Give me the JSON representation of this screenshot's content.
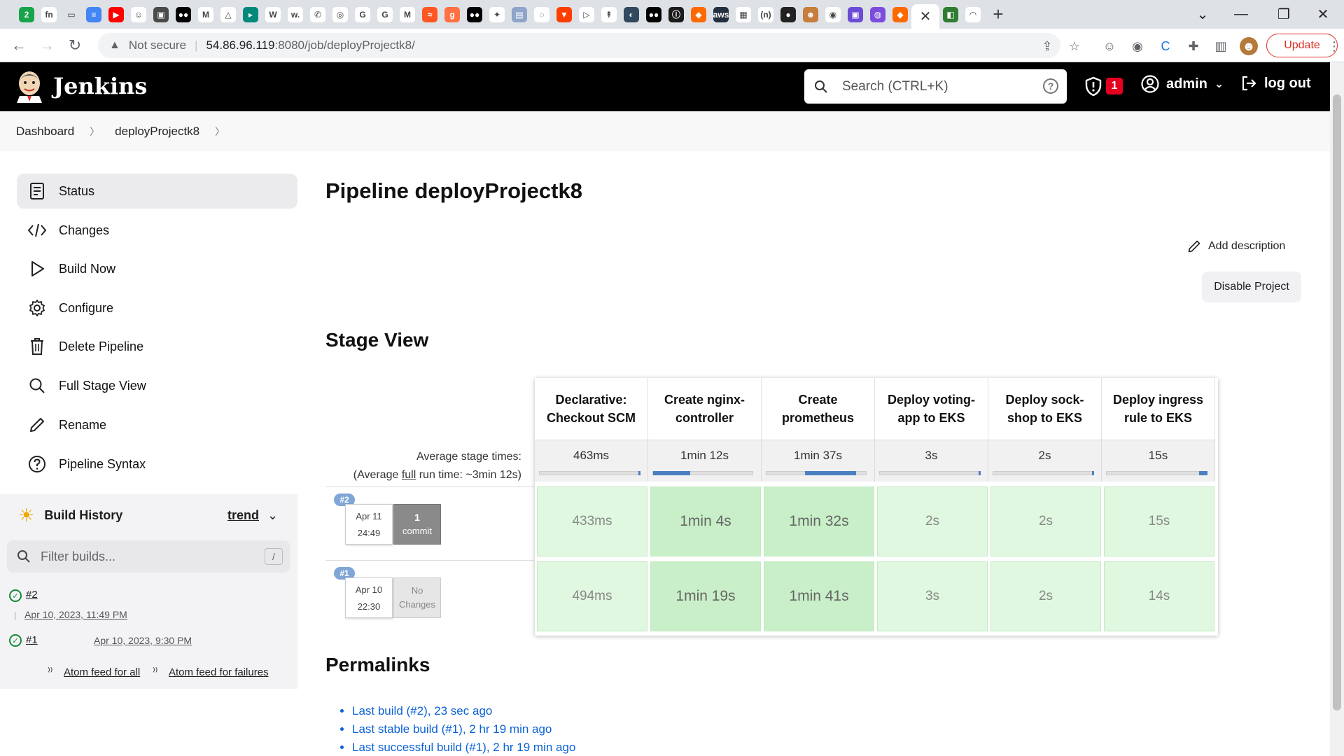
{
  "browser": {
    "tabs_favicons": [
      {
        "icon": "n8n-icon",
        "color": "#17a34a",
        "text": "2"
      },
      {
        "icon": "fn-icon",
        "color": "#ffffff",
        "text": "fn"
      },
      {
        "icon": "folder-icon",
        "color": "#dee1e6",
        "text": "▭"
      },
      {
        "icon": "docs-icon",
        "color": "#4285f4",
        "text": "≡"
      },
      {
        "icon": "youtube-icon",
        "color": "#ff0000",
        "text": "▶"
      },
      {
        "icon": "smiley-icon",
        "color": "#ffffff",
        "text": "☺"
      },
      {
        "icon": "photo-icon",
        "color": "#4a4a4a",
        "text": "▣"
      },
      {
        "icon": "medium-icon",
        "color": "#000000",
        "text": "●●"
      },
      {
        "icon": "gmail-icon",
        "color": "#ffffff",
        "text": "M"
      },
      {
        "icon": "drive-icon",
        "color": "#ffffff",
        "text": "△"
      },
      {
        "icon": "meet-icon",
        "color": "#00897b",
        "text": "▸"
      },
      {
        "icon": "w-icon",
        "color": "#ffffff",
        "text": "W"
      },
      {
        "icon": "w2-icon",
        "color": "#ffffff",
        "text": "w."
      },
      {
        "icon": "phone-icon",
        "color": "#ffffff",
        "text": "✆"
      },
      {
        "icon": "globe-icon",
        "color": "#ffffff",
        "text": "◎"
      },
      {
        "icon": "google-icon",
        "color": "#ffffff",
        "text": "G"
      },
      {
        "icon": "google2-icon",
        "color": "#ffffff",
        "text": "G"
      },
      {
        "icon": "gmail2-icon",
        "color": "#ffffff",
        "text": "M"
      },
      {
        "icon": "wave-icon",
        "color": "#ff5722",
        "text": "≈"
      },
      {
        "icon": "g-icon",
        "color": "#ff7043",
        "text": "g"
      },
      {
        "icon": "medium2-icon",
        "color": "#000000",
        "text": "●●"
      },
      {
        "icon": "star-icon",
        "color": "#ffffff",
        "text": "✦"
      },
      {
        "icon": "doc-icon",
        "color": "#8ea4c8",
        "text": "▤"
      },
      {
        "icon": "swirl-icon",
        "color": "#ffffff",
        "text": "◌"
      },
      {
        "icon": "shield2-icon",
        "color": "#ff3d00",
        "text": "▼"
      },
      {
        "icon": "play2-icon",
        "color": "#ffffff",
        "text": "▷"
      },
      {
        "icon": "pin-icon",
        "color": "#ffffff",
        "text": "↟"
      },
      {
        "icon": "circle-icon",
        "color": "#30495f",
        "text": "◐"
      },
      {
        "icon": "medium3-icon",
        "color": "#000000",
        "text": "●●"
      },
      {
        "icon": "info2-icon",
        "color": "#1b1b1b",
        "text": "ⓘ"
      },
      {
        "icon": "box-icon",
        "color": "#ff6a00",
        "text": "◆"
      },
      {
        "icon": "aws-icon",
        "color": "#232f3e",
        "text": "aws"
      },
      {
        "icon": "ms-icon",
        "color": "#ffffff",
        "text": "▦"
      },
      {
        "icon": "n-icon",
        "color": "#ffffff",
        "text": "(n)"
      },
      {
        "icon": "dot-icon",
        "color": "#222222",
        "text": "●"
      },
      {
        "icon": "avatar-tab-icon",
        "color": "#c77d3b",
        "text": "☻"
      },
      {
        "icon": "github-icon",
        "color": "#ffffff",
        "text": "◉"
      },
      {
        "icon": "purple-icon",
        "color": "#6b4cd6",
        "text": "▣"
      },
      {
        "icon": "purple2-icon",
        "color": "#7c4ddd",
        "text": "◍"
      },
      {
        "icon": "box2-icon",
        "color": "#ff6a00",
        "text": "◆"
      }
    ],
    "active_tab_close": "✕",
    "after_tabs": [
      {
        "icon": "map-icon",
        "color": "#2e7d32",
        "text": "◧"
      },
      {
        "icon": "rainbow-icon",
        "color": "#ffffff",
        "text": "◠"
      }
    ],
    "new_tab": "+",
    "url_warning": "Not secure",
    "url_host": "54.86.96.119",
    "url_path": ":8080/job/deployProjectk8/",
    "update_label": "Update"
  },
  "jenkins": {
    "brand": "Jenkins",
    "search_placeholder": "Search (CTRL+K)",
    "security_count": "1",
    "user": "admin",
    "logout": "log out"
  },
  "breadcrumb": [
    "Dashboard",
    "deployProjectk8"
  ],
  "sidebar": {
    "items": [
      {
        "label": "Status",
        "icon": "status-icon"
      },
      {
        "label": "Changes",
        "icon": "code-icon"
      },
      {
        "label": "Build Now",
        "icon": "play-icon"
      },
      {
        "label": "Configure",
        "icon": "gear-icon"
      },
      {
        "label": "Delete Pipeline",
        "icon": "trash-icon"
      },
      {
        "label": "Full Stage View",
        "icon": "search-icon"
      },
      {
        "label": "Rename",
        "icon": "pencil-icon"
      },
      {
        "label": "Pipeline Syntax",
        "icon": "help-icon"
      }
    ]
  },
  "build_history": {
    "title": "Build History",
    "trend": "trend",
    "filter_placeholder": "Filter builds...",
    "filter_key": "/",
    "builds": [
      {
        "num": "#2",
        "date": "Apr 10, 2023, 11:49 PM"
      },
      {
        "num": "#1",
        "date": "Apr 10, 2023, 9:30 PM"
      }
    ],
    "atom_all": "Atom feed for all",
    "atom_failures": "Atom feed for failures"
  },
  "main": {
    "title": "Pipeline deployProjectk8",
    "add_description": "Add description",
    "disable_project": "Disable Project",
    "stage_view_title": "Stage View",
    "avg_stage_label": "Average stage times:",
    "avg_run_prefix": "(Average ",
    "avg_run_link": "full",
    "avg_run_suffix": " run time: ~3min 12s)",
    "stages": [
      {
        "name_l1": "Declarative:",
        "name_l2": "Checkout SCM",
        "avg": "463ms",
        "bar_fraction": 0.0
      },
      {
        "name_l1": "Create nginx-",
        "name_l2": "controller",
        "avg": "1min 12s",
        "bar_fraction": 0.37
      },
      {
        "name_l1": "Create",
        "name_l2": "prometheus",
        "avg": "1min 37s",
        "bar_fraction": 0.51
      },
      {
        "name_l1": "Deploy voting-",
        "name_l2": "app to EKS",
        "avg": "3s",
        "bar_fraction": 0.02
      },
      {
        "name_l1": "Deploy sock-",
        "name_l2": "shop to EKS",
        "avg": "2s",
        "bar_fraction": 0.01
      },
      {
        "name_l1": "Deploy ingress",
        "name_l2": "rule to EKS",
        "avg": "15s",
        "bar_fraction": 0.08
      }
    ],
    "runs": [
      {
        "badge": "#2",
        "date": "Apr 11",
        "time": "24:49",
        "changes_n": "1",
        "changes_label": "commit",
        "times": [
          "433ms",
          "1min 4s",
          "1min 32s",
          "2s",
          "2s",
          "15s"
        ]
      },
      {
        "badge": "#1",
        "date": "Apr 10",
        "time": "22:30",
        "changes_n": "No",
        "changes_label": "Changes",
        "times": [
          "494ms",
          "1min 19s",
          "1min 41s",
          "3s",
          "2s",
          "14s"
        ]
      }
    ],
    "permalinks_title": "Permalinks",
    "permalinks": [
      "Last build (#2), 23 sec ago",
      "Last stable build (#1), 2 hr 19 min ago",
      "Last successful build (#1), 2 hr 19 min ago"
    ]
  }
}
